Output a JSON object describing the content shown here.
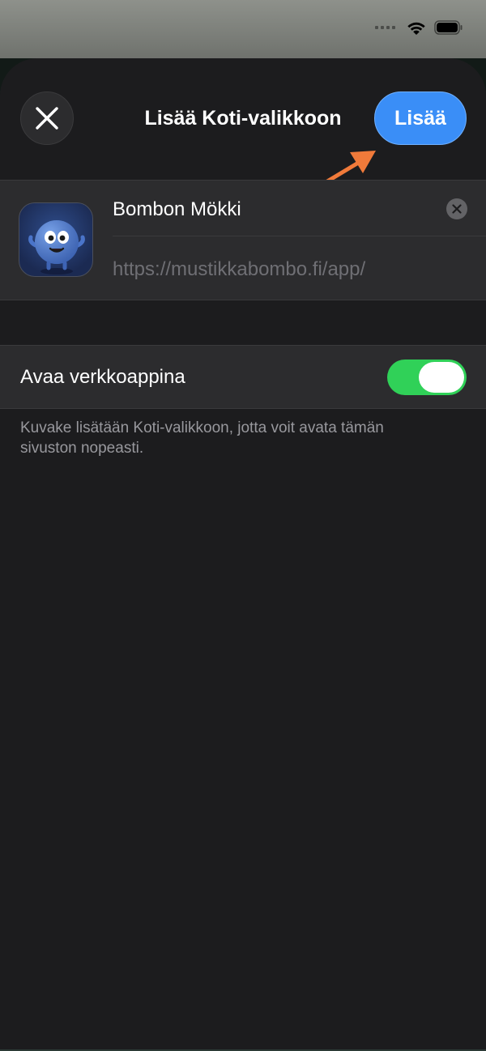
{
  "status_bar": {
    "wifi_icon": "wifi-icon",
    "battery_icon": "battery-icon"
  },
  "header": {
    "title": "Lisää Koti-valikkoon",
    "add_label": "Lisää",
    "close_icon": "close-icon"
  },
  "app": {
    "name": "Bombon Mökki",
    "url": "https://mustikkabombo.fi/app/",
    "icon": "blueberry-mascot-icon"
  },
  "settings": {
    "web_app_label": "Avaa verkkoappina",
    "web_app_enabled": true
  },
  "footnote": "Kuvake lisätään Koti-valikkoon, jotta voit avata tämän sivuston nopeasti.",
  "colors": {
    "accent": "#3a8ef7",
    "toggle_on": "#30d158",
    "annotation_arrow": "#f07a3a",
    "background": "#1c1c1e",
    "cell": "#2c2c2e"
  }
}
